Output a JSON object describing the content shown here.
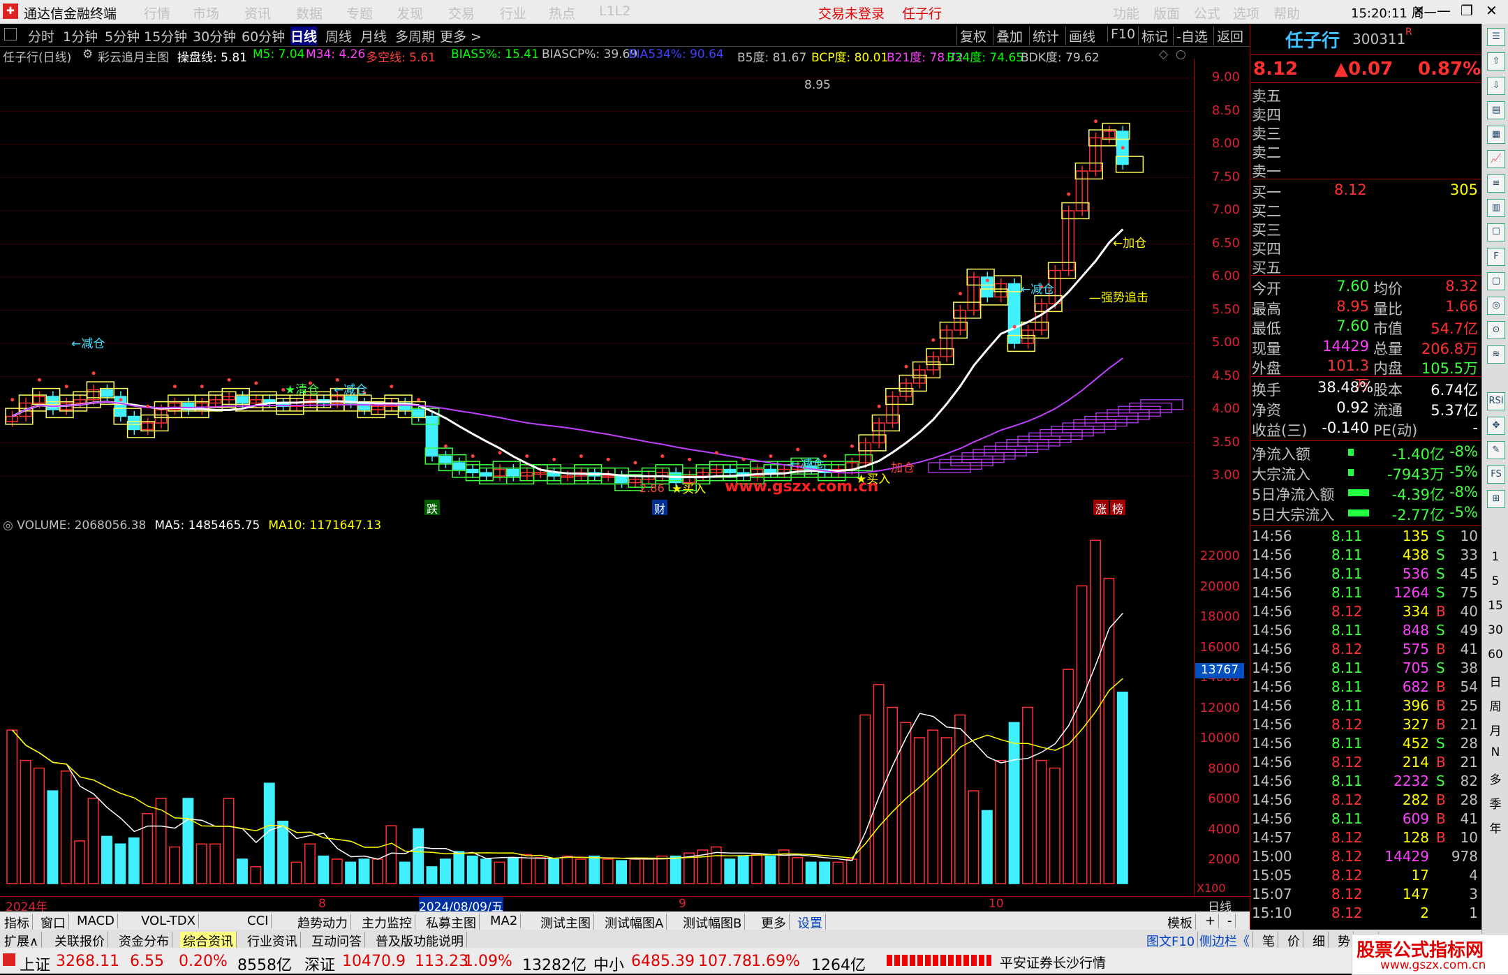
{
  "titlebar": {
    "app_title": "通达信金融终端",
    "menus": [
      "行情",
      "市场",
      "资讯",
      "数据",
      "专题",
      "发现",
      "交易",
      "行业",
      "热点",
      "L1L2"
    ],
    "status_login": "交易未登录",
    "stock_name": "任子行",
    "right_menus": [
      "功能",
      "版面",
      "公式",
      "选项",
      "帮助"
    ],
    "time": "15:20:11",
    "weekday": "周一"
  },
  "periods": [
    "分时",
    "1分钟",
    "5分钟",
    "15分钟",
    "30分钟",
    "60分钟",
    "日线",
    "周线",
    "月线",
    "多周期",
    "更多 >"
  ],
  "active_period": "日线",
  "right_tools": [
    "复权",
    "叠加",
    "统计",
    "画线",
    "F10",
    "标记",
    "-自选",
    "返回"
  ],
  "indicator_line": {
    "stock": "任子行(日线)",
    "main_formula": "彩云追月主图",
    "items": [
      {
        "text": "操盘线: 5.81",
        "color": "#ffffff"
      },
      {
        "text": "M5: 7.04",
        "color": "#00ff00"
      },
      {
        "text": "M34: 4.26",
        "color": "#ff40ff"
      },
      {
        "text": "多空线: 5.61",
        "color": "#ff4040"
      },
      {
        "text": "BIAS5%: 15.41",
        "color": "#00ff00"
      },
      {
        "text": "BIASCP%: 39.69",
        "color": "#c0c0c0"
      },
      {
        "text": "BIA534%: 90.64",
        "color": "#4040ff"
      },
      {
        "text": "B5度: 81.67",
        "color": "#c0c0c0"
      },
      {
        "text": "BCP度: 80.01",
        "color": "#ffff00"
      },
      {
        "text": "B21度: 78.72",
        "color": "#ff40ff"
      },
      {
        "text": "B34度: 74.65",
        "color": "#00ff00"
      },
      {
        "text": "BDK度: 79.62",
        "color": "#c0c0c0"
      }
    ]
  },
  "kchart": {
    "y_ticks": [
      "9.00",
      "8.50",
      "8.00",
      "7.50",
      "7.00",
      "6.50",
      "6.00",
      "5.50",
      "5.00",
      "4.50",
      "4.00",
      "3.50",
      "3.00"
    ],
    "high_label": "8.95",
    "low_label": "2.86",
    "annotations": [
      "←减仓",
      "←减仓",
      "★清仓",
      "←减仓",
      "←减仓",
      "★买入",
      "★买入",
      "←减仓",
      "←加仓",
      "—强势追击",
      "加仓"
    ],
    "markers": [
      "跌",
      "财",
      "涨",
      "榜"
    ],
    "watermark": "www.gszx.com.cn"
  },
  "vchart": {
    "legend": [
      {
        "text": "VOLUME: 2068056.38",
        "color": "#c0c0c0"
      },
      {
        "text": "MA5: 1485465.75",
        "color": "#ffffff"
      },
      {
        "text": "MA10: 1171647.13",
        "color": "#ffff00"
      }
    ],
    "y_ticks": [
      "22000",
      "20000",
      "18000",
      "16000",
      "14000",
      "12000",
      "10000",
      "8000",
      "6000",
      "4000",
      "2000"
    ],
    "cursor_value": "13767",
    "unit": "X100"
  },
  "xaxis": {
    "labels": [
      "2024年",
      "8",
      "2024/08/09/五",
      "9",
      "10"
    ],
    "right": "日线"
  },
  "tabs1": [
    "指标",
    "窗口",
    "MACD",
    "VOL-TDX",
    "CCI",
    "趋势动力",
    "主力监控",
    "私募主图",
    "MA2",
    "测试主图",
    "测试幅图A",
    "测试幅图B",
    "更多",
    "设置"
  ],
  "tabs1_right": [
    "模板",
    "+",
    "-"
  ],
  "tabs2": [
    "扩展∧",
    "关联报价",
    "资金分布",
    "综合资讯",
    "行业资讯",
    "互动问答",
    "普及版功能说明"
  ],
  "panel": {
    "name": "任子行",
    "code": "300311",
    "price": "8.12",
    "change": "▲0.07",
    "pct": "0.87%",
    "sells": [
      "卖五",
      "卖四",
      "卖三",
      "卖二",
      "卖一"
    ],
    "buys": [
      {
        "label": "买一",
        "price": "8.12",
        "vol": "305"
      },
      {
        "label": "买二",
        "price": "",
        "vol": ""
      },
      {
        "label": "买三",
        "price": "",
        "vol": ""
      },
      {
        "label": "买四",
        "price": "",
        "vol": ""
      },
      {
        "label": "买五",
        "price": "",
        "vol": ""
      }
    ],
    "stats": [
      [
        "今开",
        "7.60",
        "均价",
        "8.32"
      ],
      [
        "最高",
        "8.95",
        "量比",
        "1.66"
      ],
      [
        "最低",
        "7.60",
        "市值",
        "54.7亿"
      ],
      [
        "现量",
        "14429",
        "总量",
        "206.8万"
      ],
      [
        "外盘",
        "101.3万",
        "内盘",
        "105.5万"
      ]
    ],
    "stats2": [
      [
        "换手",
        "38.48%",
        "股本",
        "6.74亿"
      ],
      [
        "净资",
        "0.92",
        "流通",
        "5.37亿"
      ],
      [
        "收益(三)",
        "-0.140",
        "PE(动)",
        "-"
      ]
    ],
    "flows": [
      [
        "净流入额",
        "-1.40亿",
        "-8%"
      ],
      [
        "大宗流入",
        "-7943万",
        "-5%"
      ],
      [
        "5日净流入额",
        "-4.39亿",
        "-8%"
      ],
      [
        "5日大宗流入",
        "-2.77亿",
        "-5%"
      ]
    ],
    "ticks": [
      [
        "14:56",
        "8.11",
        "135",
        "S",
        "10"
      ],
      [
        "14:56",
        "8.11",
        "438",
        "S",
        "33"
      ],
      [
        "14:56",
        "8.11",
        "536",
        "S",
        "45"
      ],
      [
        "14:56",
        "8.11",
        "1264",
        "S",
        "75"
      ],
      [
        "14:56",
        "8.12",
        "334",
        "B",
        "40"
      ],
      [
        "14:56",
        "8.11",
        "848",
        "S",
        "49"
      ],
      [
        "14:56",
        "8.12",
        "575",
        "B",
        "41"
      ],
      [
        "14:56",
        "8.11",
        "705",
        "S",
        "38"
      ],
      [
        "14:56",
        "8.11",
        "682",
        "B",
        "54"
      ],
      [
        "14:56",
        "8.11",
        "396",
        "B",
        "25"
      ],
      [
        "14:56",
        "8.12",
        "327",
        "B",
        "21"
      ],
      [
        "14:56",
        "8.11",
        "452",
        "S",
        "28"
      ],
      [
        "14:56",
        "8.12",
        "214",
        "B",
        "21"
      ],
      [
        "14:56",
        "8.11",
        "2232",
        "S",
        "82"
      ],
      [
        "14:56",
        "8.12",
        "282",
        "B",
        "28"
      ],
      [
        "14:56",
        "8.11",
        "609",
        "B",
        "41"
      ],
      [
        "14:57",
        "8.12",
        "128",
        "B",
        "10"
      ],
      [
        "15:00",
        "8.12",
        "14429",
        "",
        "978"
      ],
      [
        "15:05",
        "8.12",
        "17",
        "",
        "4"
      ],
      [
        "15:07",
        "8.12",
        "147",
        "",
        "3"
      ],
      [
        "15:10",
        "8.12",
        "2",
        "",
        "1"
      ]
    ],
    "bottom_tabs": [
      "笔",
      "价",
      "细",
      "势",
      "联"
    ],
    "bottom_left": [
      "图文F10",
      "侧边栏《"
    ]
  },
  "sidebar_cal": [
    "1",
    "5",
    "15",
    "30",
    "60",
    "日",
    "周",
    "月",
    "N",
    "多",
    "季",
    "年"
  ],
  "status": {
    "sh_label": "上证",
    "sh_val": "3268.11",
    "sh_chg": "6.55",
    "sh_pct": "0.20%",
    "sh_amt": "8558亿",
    "sz_label": "深证",
    "sz_val": "10470.9",
    "sz_chg": "113.23",
    "sz_pct": "1.09%",
    "sz_amt": "13282亿",
    "zx_label": "中小",
    "zx_val": "6485.39",
    "zx_chg": "107.78",
    "zx_pct": "1.69%",
    "zx_amt": "1264亿",
    "broker": "平安证券长沙行情",
    "brand": "股票公式指标网",
    "brand_url": "www.gszx.com.cn"
  }
}
